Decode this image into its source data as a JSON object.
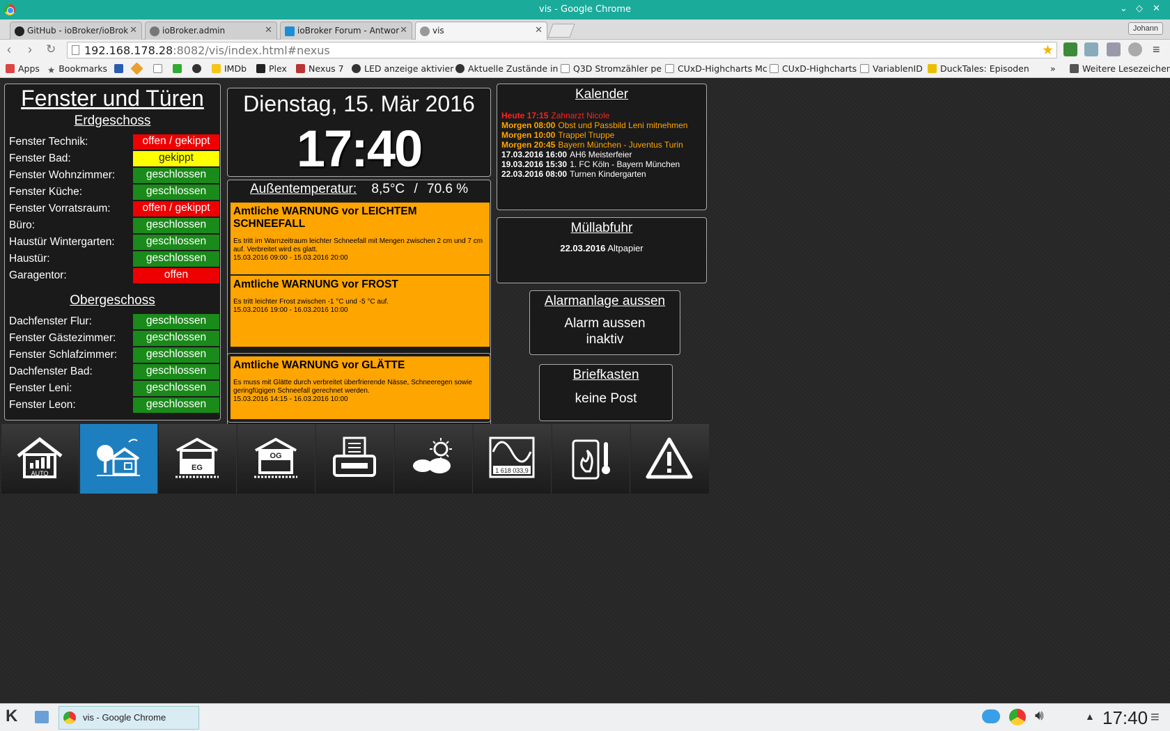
{
  "window": {
    "title": "vis - Google Chrome",
    "controls": [
      "⌄",
      "◇",
      "✕"
    ]
  },
  "tabs": [
    {
      "label": "GitHub - ioBroker/ioBrok",
      "icon": "github-icon",
      "active": false
    },
    {
      "label": "ioBroker.admin",
      "icon": "gear-icon",
      "active": false
    },
    {
      "label": "ioBroker Forum - Antwor",
      "icon": "iobroker-icon",
      "active": false
    },
    {
      "label": "vis",
      "icon": "vis-icon",
      "active": true
    }
  ],
  "profile_button": "Johann",
  "address_bar": {
    "host": "192.168.178.28",
    "path": ":8082/vis/index.html#nexus"
  },
  "bookmarks": {
    "apps": "Apps",
    "items": [
      "Bookmarks",
      "IMDb",
      "Plex",
      "Nexus 7",
      "LED anzeige aktivier",
      "Aktuelle Zustände in",
      "Q3D Stromzähler pe",
      "CUxD-Highcharts Mc",
      "CUxD-Highcharts",
      "VariablenID",
      "DuckTales: Episoden"
    ],
    "more": "»",
    "other": "Weitere Lesezeichen"
  },
  "windows_panel": {
    "title": "Fenster und Türen",
    "ground_floor_title": "Erdgeschoss",
    "ground_floor": [
      {
        "label": "Fenster Technik:",
        "status": "offen / gekippt",
        "color": "red"
      },
      {
        "label": "Fenster Bad:",
        "status": "gekippt",
        "color": "yellow"
      },
      {
        "label": "Fenster Wohnzimmer:",
        "status": "geschlossen",
        "color": "green"
      },
      {
        "label": "Fenster Küche:",
        "status": "geschlossen",
        "color": "green"
      },
      {
        "label": "Fenster Vorratsraum:",
        "status": "offen / gekippt",
        "color": "red"
      },
      {
        "label": "Büro:",
        "status": "geschlossen",
        "color": "green"
      },
      {
        "label": "Haustür Wintergarten:",
        "status": "geschlossen",
        "color": "green"
      },
      {
        "label": "Haustür:",
        "status": "geschlossen",
        "color": "green"
      },
      {
        "label": "Garagentor:",
        "status": "offen",
        "color": "red"
      }
    ],
    "upper_floor_title": "Obergeschoss",
    "upper_floor": [
      {
        "label": "Dachfenster Flur:",
        "status": "geschlossen",
        "color": "green"
      },
      {
        "label": "Fenster Gästezimmer:",
        "status": "geschlossen",
        "color": "green"
      },
      {
        "label": "Fenster Schlafzimmer:",
        "status": "geschlossen",
        "color": "green"
      },
      {
        "label": "Dachfenster Bad:",
        "status": "geschlossen",
        "color": "green"
      },
      {
        "label": "Fenster Leni:",
        "status": "geschlossen",
        "color": "green"
      },
      {
        "label": "Fenster Leon:",
        "status": "geschlossen",
        "color": "green"
      }
    ]
  },
  "clock": {
    "date": "Dienstag, 15. Mär 2016",
    "time": "17:40"
  },
  "weather": {
    "temp_label": "Außentemperatur:",
    "temp": "8,5°C",
    "separator": "/",
    "humidity": "70.6 %",
    "warnings": [
      {
        "title": "Amtliche WARNUNG vor LEICHTEM SCHNEEFALL",
        "text": "Es tritt im Warnzeitraum leichter Schneefall mit Mengen zwischen 2 cm und 7 cm auf. Verbreitet wird es glatt.",
        "period": "15.03.2016 09:00 - 15.03.2016 20:00"
      },
      {
        "title": "Amtliche WARNUNG vor FROST",
        "text": "Es tritt leichter Frost zwischen -1 °C und -5 °C auf.",
        "period": "15.03.2016 19:00 - 16.03.2016 10:00"
      },
      {
        "title": "Amtliche WARNUNG vor GLÄTTE",
        "text": "Es muss mit Glätte durch verbreitet überfrierende Nässe, Schneeregen sowie geringfügigen Schneefall gerechnet werden.",
        "period": "15.03.2016 14:15 - 16.03.2016 10:00"
      }
    ]
  },
  "calendar": {
    "title": "Kalender",
    "entries": [
      {
        "when": "Heute 17:15",
        "what": "Zahnarzt Nicole",
        "color": "#ff2222"
      },
      {
        "when": "Morgen 08:00",
        "what": "Obst und Passbild Leni mitnehmen",
        "color": "#ffa500"
      },
      {
        "when": "Morgen 10:00",
        "what": "Trappel Truppe",
        "color": "#ffa500"
      },
      {
        "when": "Morgen 20:45",
        "what": "Bayern München - Juventus Turin",
        "color": "#ffa500"
      },
      {
        "when": "17.03.2016 16:00",
        "what": "AH6 Meisterfeier",
        "color": "#ffffff"
      },
      {
        "when": "19.03.2016 15:30",
        "what": "1. FC Köln - Bayern München",
        "color": "#ffffff"
      },
      {
        "when": "22.03.2016 08:00",
        "what": "Turnen Kindergarten",
        "color": "#ffffff"
      }
    ]
  },
  "waste": {
    "title": "Müllabfuhr",
    "date": "22.03.2016",
    "type": "Altpapier"
  },
  "alarm": {
    "title": "Alarmanlage aussen",
    "line1": "Alarm aussen",
    "line2": "inaktiv"
  },
  "mailbox": {
    "title": "Briefkasten",
    "status": "keine Post"
  },
  "navigation": {
    "selected_index": 1,
    "tiles": [
      "house-auto-icon",
      "house-garden-icon",
      "house-eg-icon",
      "house-og-icon",
      "fax-icon",
      "weather-icon",
      "power-meter-icon",
      "heating-icon",
      "warning-icon"
    ],
    "tile_labels": {
      "auto": "AUTO",
      "eg": "EG",
      "og": "OG",
      "meter": "1 618 033,9"
    }
  },
  "taskbar": {
    "task_label": "vis - Google Chrome",
    "clock": "17:40"
  }
}
